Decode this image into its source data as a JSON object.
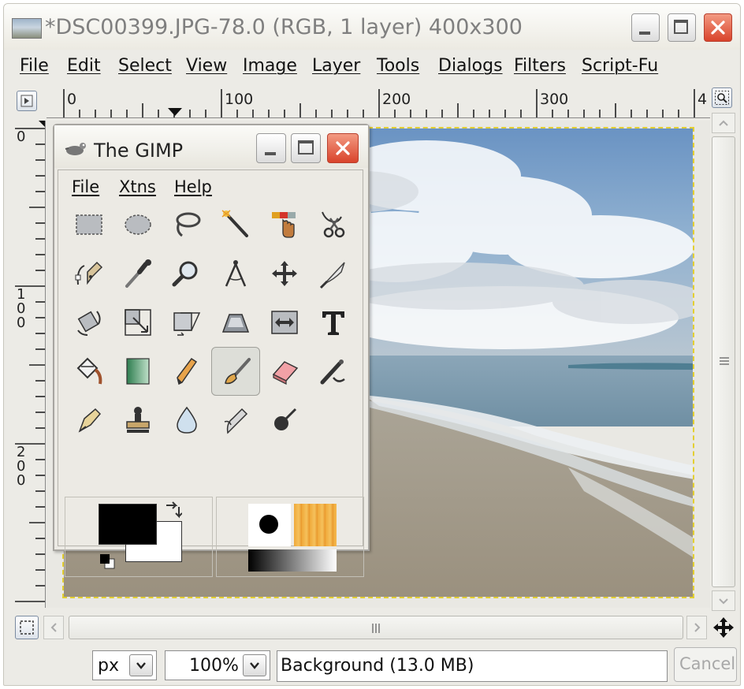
{
  "window": {
    "title": "*DSC00399.JPG-78.0 (RGB, 1 layer) 400x300"
  },
  "menu": {
    "items": [
      "File",
      "Edit",
      "Select",
      "View",
      "Image",
      "Layer",
      "Tools",
      "Dialogs",
      "Filters",
      "Script-Fu"
    ]
  },
  "ruler": {
    "h_labels": [
      "0",
      "100",
      "200",
      "300",
      "4"
    ],
    "v_labels": [
      "0",
      "1\n0\n0",
      "2\n0\n0"
    ]
  },
  "toolbox": {
    "title": "The GIMP",
    "menu": [
      "File",
      "Xtns",
      "Help"
    ],
    "tools": [
      "rect-select-icon",
      "ellipse-select-icon",
      "lasso-icon",
      "fuzzy-select-icon",
      "select-by-color-icon",
      "scissors-icon",
      "paths-icon",
      "color-picker-icon",
      "magnify-icon",
      "measure-icon",
      "move-icon",
      "crop-icon",
      "rotate-icon",
      "scale-icon",
      "shear-icon",
      "perspective-icon",
      "flip-icon",
      "text-icon",
      "bucket-fill-icon",
      "blend-icon",
      "pencil-icon",
      "paintbrush-icon",
      "eraser-icon",
      "airbrush-icon",
      "ink-icon",
      "clone-icon",
      "blur-icon",
      "smudge-icon",
      "dodge-burn-icon"
    ],
    "active_tool": "paintbrush-icon",
    "foreground_color": "#000000",
    "background_color": "#ffffff"
  },
  "status": {
    "unit": "px",
    "zoom": "100%",
    "layer_info": "Background (13.0 MB)",
    "cancel_label": "Cancel"
  },
  "colors": {
    "selection_border": "#e3cf32",
    "close_button": "#d9432b"
  }
}
